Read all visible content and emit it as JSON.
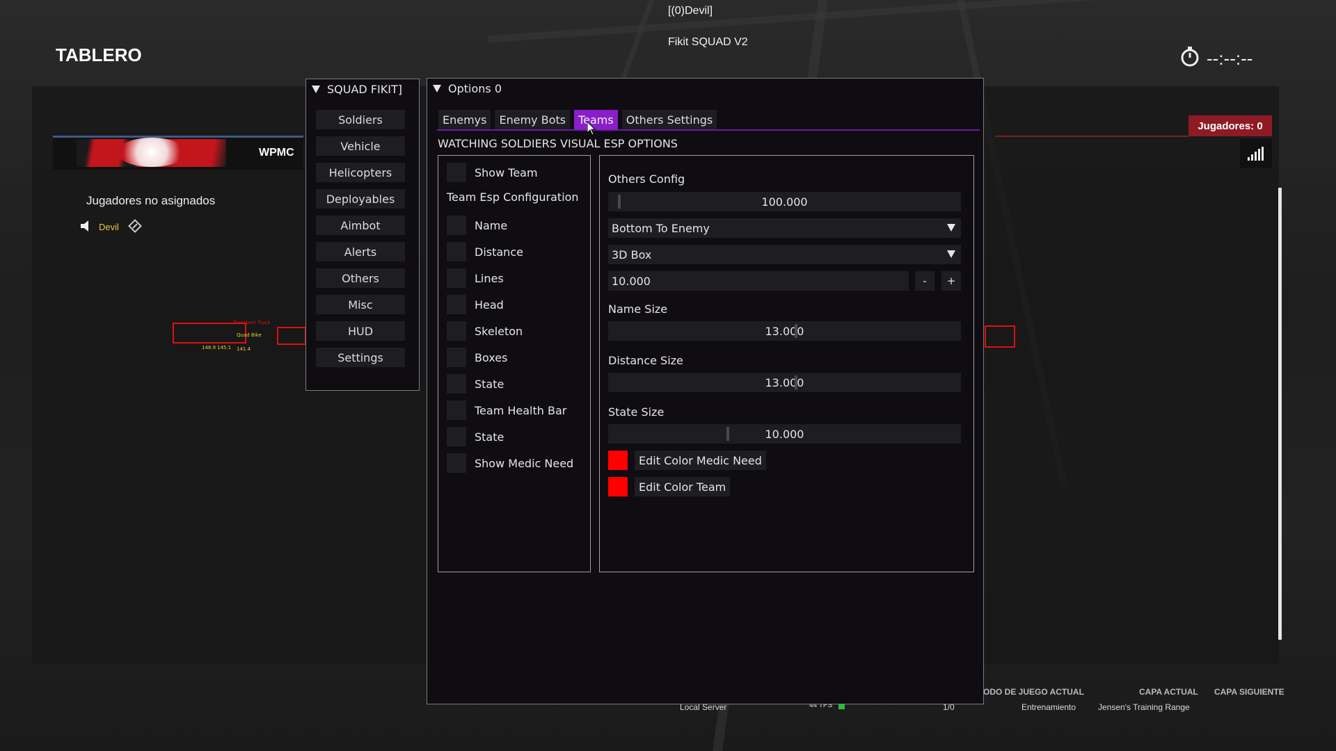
{
  "game": {
    "player_tag": "[(0)Devil]",
    "cheat_title": "Fikit SQUAD V2",
    "scoreboard_title": "TABLERO",
    "timer": "--:--:--",
    "team_name": "WPMC",
    "unassigned_label": "Jugadores no asignados",
    "player_name": "Devil",
    "players_badge": "Jugadores: 0",
    "bottom": {
      "server": "Local Server",
      "tps": "44 TPS",
      "count": "1/0",
      "mode_label": "ODO DE JUEGO ACTUAL",
      "mode_value": "Entrenamiento",
      "layer_label": "CAPA ACTUAL",
      "layer_value": "Jensen's Training Range",
      "next_label": "CAPA SIGUIENTE"
    },
    "esp_labels": [
      "148.9",
      "145.1",
      "141.4",
      "Quad Bike",
      "Transport Truck"
    ]
  },
  "menu": {
    "title": "SQUAD FIKIT]",
    "items": [
      "Soldiers",
      "Vehicle",
      "Helicopters",
      "Deployables",
      "Aimbot",
      "Alerts",
      "Others",
      "Misc",
      "HUD",
      "Settings"
    ]
  },
  "options": {
    "title": "Options 0",
    "tabs": [
      "Enemys",
      "Enemy Bots",
      "Teams",
      "Others Settings"
    ],
    "active_tab": "Teams",
    "section_title": "WATCHING SOLDIERS VISUAL ESP OPTIONS",
    "left": {
      "show_team": "Show Team",
      "config_heading": "Team Esp Configuration",
      "checks": [
        "Name",
        "Distance",
        "Lines",
        "Head",
        "Skeleton",
        "Boxes",
        "State",
        "Team Health Bar",
        "State",
        "Show Medic Need"
      ]
    },
    "right": {
      "heading": "Others Config",
      "slider1": "100.000",
      "combo1": "Bottom To Enemy",
      "combo2": "3D Box",
      "input_value": "10.000",
      "minus": "-",
      "plus": "+",
      "name_size_label": "Name Size",
      "name_size": "13.000",
      "distance_size_label": "Distance Size",
      "distance_size": "13.000",
      "state_size_label": "State Size",
      "state_size": "10.000",
      "color_medic": "Edit Color Medic Need",
      "color_team": "Edit Color Team",
      "color_value": "#ff0000"
    }
  }
}
